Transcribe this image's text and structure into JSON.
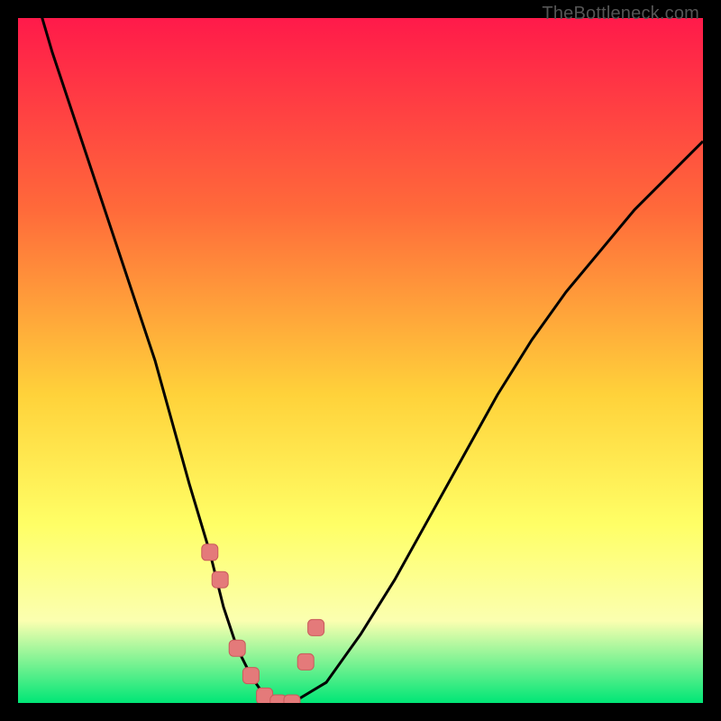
{
  "watermark": "TheBottleneck.com",
  "colors": {
    "frame": "#000000",
    "curve": "#000000",
    "marker_fill": "#e47a7a",
    "marker_stroke": "#c95b5b",
    "grad_top": "#ff1a4a",
    "grad_mid1": "#ff6a3a",
    "grad_mid2": "#ffd23a",
    "grad_mid3": "#ffff66",
    "grad_mid4": "#fbffb0",
    "grad_bottom": "#00e676"
  },
  "chart_data": {
    "type": "line",
    "title": "",
    "xlabel": "",
    "ylabel": "",
    "xlim": [
      0,
      100
    ],
    "ylim": [
      0,
      100
    ],
    "series": [
      {
        "name": "bottleneck-curve",
        "x": [
          0,
          5,
          10,
          15,
          20,
          25,
          28,
          30,
          32,
          34,
          36,
          38,
          40,
          45,
          50,
          55,
          60,
          65,
          70,
          75,
          80,
          85,
          90,
          95,
          100
        ],
        "y": [
          112,
          95,
          80,
          65,
          50,
          32,
          22,
          14,
          8,
          4,
          1,
          0,
          0,
          3,
          10,
          18,
          27,
          36,
          45,
          53,
          60,
          66,
          72,
          77,
          82
        ]
      }
    ],
    "markers": {
      "name": "highlight-points",
      "x": [
        28,
        29.5,
        32,
        34,
        36,
        38,
        40,
        42,
        43.5
      ],
      "y": [
        22,
        18,
        8,
        4,
        1,
        0,
        0,
        6,
        11
      ]
    }
  }
}
